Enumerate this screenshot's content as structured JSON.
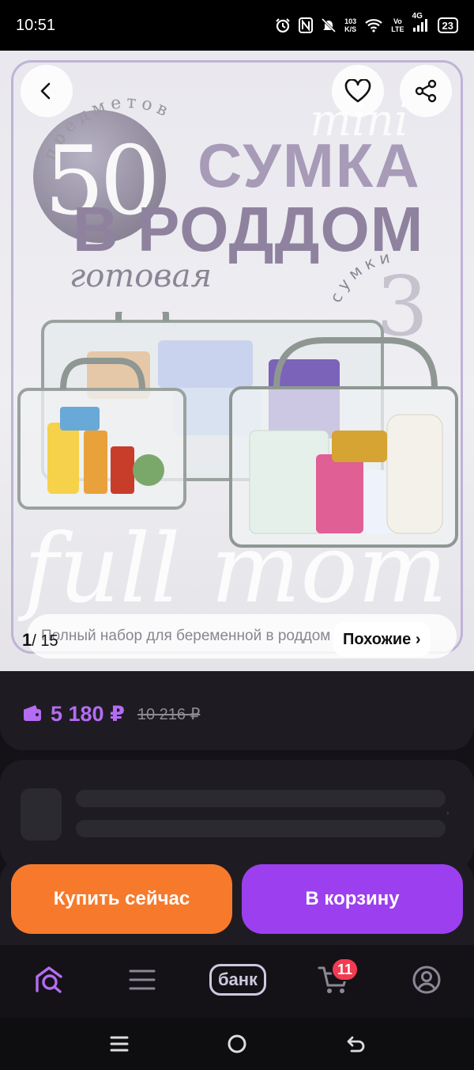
{
  "status_bar": {
    "time": "10:51",
    "speed_value": "103",
    "speed_unit": "K/S",
    "volte_top": "Vo",
    "volte_bottom": "LTE",
    "network": "4G",
    "battery": "23"
  },
  "gallery": {
    "badge_arc_text": "предметов",
    "badge_number": "50",
    "title_line1": "СУМКА",
    "title_line2": "В РОДДОМ",
    "subtitle": "готовая",
    "ghost_mini": "mini",
    "ghost_full": "full mom",
    "count_arc_text": "сумки",
    "count_number": "3",
    "caption": "Полный набор для беременной в роддом",
    "counter_current": "1",
    "counter_total": "/ 15",
    "similar_label": "Похожие ›",
    "frame_color": "#bfb3d6"
  },
  "price": {
    "current": "5 180 ₽",
    "old": "10 216 ₽",
    "accent_color": "#b46cf2",
    "icon": "wallet-icon"
  },
  "actions": {
    "buy_now": "Купить сейчас",
    "add_to_cart": "В корзину",
    "buy_color": "#f77a2c",
    "cart_color": "#9b3fef"
  },
  "bottom_nav": {
    "home_icon": "home-search-icon",
    "catalog_icon": "menu-icon",
    "bank_label": "банк",
    "cart_icon": "cart-icon",
    "cart_count": "11",
    "profile_icon": "profile-icon"
  },
  "system_nav": {
    "recents_icon": "recents-icon",
    "home_icon": "circle-home-icon",
    "back_icon": "back-arrow-icon"
  }
}
